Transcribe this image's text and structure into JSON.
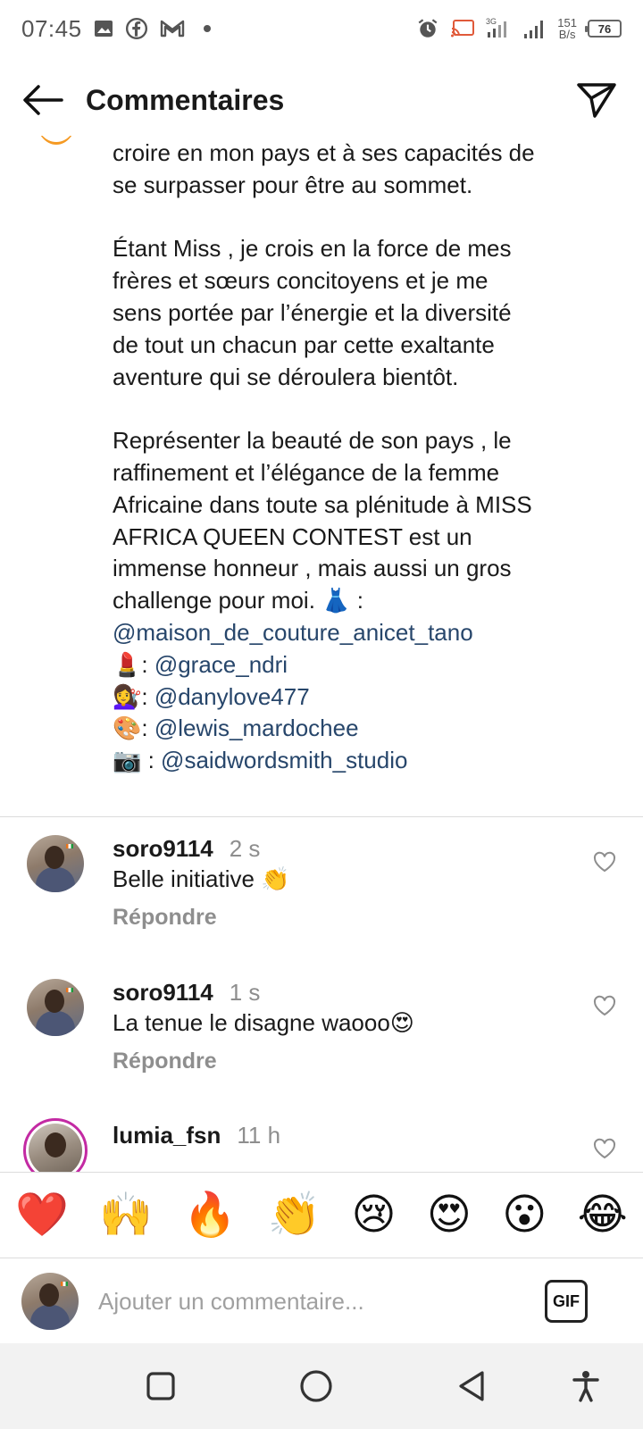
{
  "status_bar": {
    "time": "07:45",
    "net_speed_value": "151",
    "net_speed_unit": "B/s",
    "battery": "76",
    "signal_label": "3G"
  },
  "header": {
    "title": "Commentaires"
  },
  "caption": {
    "lines_block1": "croire en mon pays et à ses capacités de\nse surpasser pour être au sommet.",
    "lines_block2": "Étant Miss , je crois en la force de mes\nfrères et sœurs concitoyens et je me\nsens portée par l’énergie et la diversité\nde tout un chacun par cette exaltante\naventure qui se déroulera bientôt.",
    "lines_block3": "Représenter la beauté de son pays , le\nraffinement et l’élégance de la femme\nAfricaine dans toute sa plénitude à MISS\nAFRICA QUEEN CONTEST est un\nimmense honneur , mais aussi un gros\nchallenge pour moi. 👗 :",
    "credits": [
      {
        "prefix": "",
        "mention": "@maison_de_couture_anicet_tano"
      },
      {
        "prefix": "💄: ",
        "mention": "@grace_ndri"
      },
      {
        "prefix": "💇‍♀️: ",
        "mention": "@danylove477"
      },
      {
        "prefix": "🎨: ",
        "mention": "@lewis_mardochee"
      },
      {
        "prefix": "📷 : ",
        "mention": "@saidwordsmith_studio"
      }
    ]
  },
  "comments": [
    {
      "username": "soro9114",
      "time": "2 s",
      "text": "Belle initiative 👏",
      "reply": "Répondre"
    },
    {
      "username": "soro9114",
      "time": "1 s",
      "text": "La tenue le disagne waooo😍",
      "reply": "Répondre"
    },
    {
      "username": "lumia_fsn",
      "time": "11 h",
      "text": "",
      "reply": ""
    }
  ],
  "emoji_bar": [
    "❤️",
    "🙌",
    "🔥",
    "👏",
    "😢",
    "😍",
    "😮",
    "😂"
  ],
  "add_comment": {
    "placeholder": "Ajouter un commentaire...",
    "gif_label": "GIF"
  },
  "colors": {
    "mention": "#27466b",
    "secondary_text": "#8e8e8e",
    "story_ring": "#c32aa3"
  }
}
